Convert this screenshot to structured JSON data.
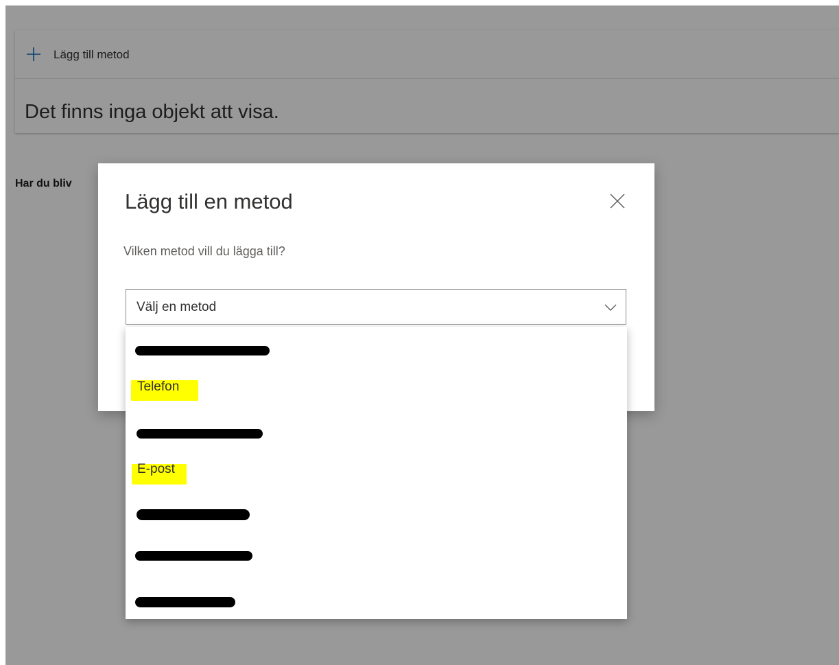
{
  "background": {
    "add_method_label": "Lägg till metod",
    "empty_message": "Det finns inga objekt att visa.",
    "question_partial": "Har du bliv"
  },
  "dialog": {
    "title": "Lägg till en metod",
    "question": "Vilken metod vill du lägga till?",
    "select": {
      "value": "Välj en metod"
    },
    "options": [
      {
        "label": "",
        "redacted": true
      },
      {
        "label": "Telefon",
        "redacted": false,
        "highlighted": true
      },
      {
        "label": "",
        "redacted": true
      },
      {
        "label": "E-post",
        "redacted": false,
        "highlighted": true
      },
      {
        "label": "",
        "redacted": true
      },
      {
        "label": "",
        "redacted": true
      },
      {
        "label": "",
        "redacted": true
      }
    ]
  },
  "colors": {
    "highlight": "#ffff00",
    "overlay": "rgba(0,0,0,0.4)",
    "text": "#323130"
  }
}
